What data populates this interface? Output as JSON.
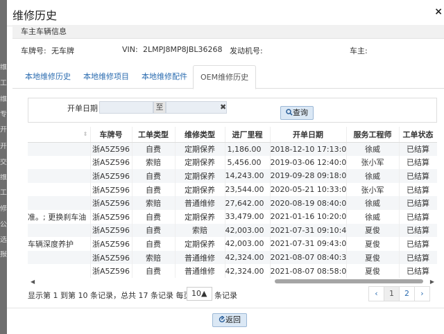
{
  "modal": {
    "title": "维修历史",
    "close_glyph": "×"
  },
  "backdrop": [
    "维",
    "工",
    "维",
    "专",
    "开",
    "开",
    "交",
    "维",
    "工",
    "修",
    "公",
    "选",
    "报"
  ],
  "owner_info": {
    "section_title": "车主车辆信息",
    "plate_label": "车牌号:",
    "plate_value": "无车牌",
    "vin_label": "VIN:",
    "vin_value": "2LMPJ8MP8JBL36268",
    "engine_label": "发动机号:",
    "engine_value": "",
    "owner_label": "车主:",
    "owner_value": ""
  },
  "tabs": [
    {
      "label": "本地维修历史",
      "active": false
    },
    {
      "label": "本地维修项目",
      "active": false
    },
    {
      "label": "本地维修配件",
      "active": false
    },
    {
      "label": "OEM维修历史",
      "active": true
    }
  ],
  "search": {
    "date_label": "开单日期",
    "start_value": "",
    "separator": "至",
    "end_value": "",
    "clear_glyph": "✖",
    "query_label": "查询",
    "query_icon": "search-icon"
  },
  "table": {
    "columns": [
      "",
      "车牌号",
      "工单类型",
      "维修类型",
      "进厂里程",
      "开单日期",
      "服务工程师",
      "工单状态"
    ],
    "rows": [
      [
        "",
        "浙A5Z596",
        "自费",
        "定期保养",
        "1,186.00",
        "2018-12-10 17:13:00",
        "徐威",
        "已结算"
      ],
      [
        "",
        "浙A5Z596",
        "索赔",
        "定期保养",
        "5,456.00",
        "2019-03-06 12:40:00",
        "张小军",
        "已结算"
      ],
      [
        "",
        "浙A5Z596",
        "自费",
        "定期保养",
        "14,243.00",
        "2019-09-28 09:18:00",
        "徐威",
        "已结算"
      ],
      [
        "",
        "浙A5Z596",
        "自费",
        "定期保养",
        "23,544.00",
        "2020-05-21 10:33:00",
        "张小军",
        "已结算"
      ],
      [
        "",
        "浙A5Z596",
        "索赔",
        "普通维修",
        "27,642.00",
        "2020-08-19 08:40:00",
        "徐威",
        "已结算"
      ],
      [
        "准。; 更换刹车油",
        "浙A5Z596",
        "自费",
        "定期保养",
        "33,479.00",
        "2021-01-16 10:20:00",
        "徐威",
        "已结算"
      ],
      [
        "",
        "浙A5Z596",
        "自费",
        "索赔",
        "42,003.00",
        "2021-07-31 09:10:49",
        "夏俊",
        "已结算"
      ],
      [
        "车辆深度养护",
        "浙A5Z596",
        "自费",
        "定期保养",
        "42,003.00",
        "2021-07-31 09:43:00",
        "夏俊",
        "已结算"
      ],
      [
        "",
        "浙A5Z596",
        "索赔",
        "普通维修",
        "42,324.00",
        "2021-08-07 08:40:39",
        "夏俊",
        "已结算"
      ],
      [
        "",
        "浙A5Z596",
        "自费",
        "普通维修",
        "42,324.00",
        "2021-08-07 08:58:00",
        "夏俊",
        "已结算"
      ]
    ],
    "scroll_left_glyph": "◀",
    "scroll_right_glyph": "▶"
  },
  "pager": {
    "info": "显示第 1 到第 10 条记录，总共 17 条记录 每页显示",
    "page_size": "10▲",
    "suffix": "条记录",
    "prev": "‹",
    "pages": [
      "1",
      "2"
    ],
    "current": "1",
    "next": "›"
  },
  "footer": {
    "back_label": "返回"
  }
}
